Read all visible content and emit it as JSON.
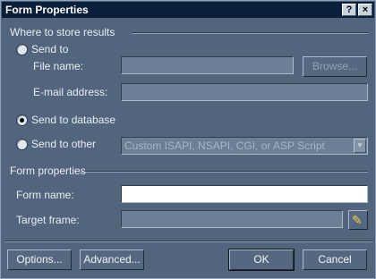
{
  "window": {
    "title": "Form Properties",
    "help_button": "?",
    "close_button": "×"
  },
  "storage_group": {
    "title": "Where to store results",
    "send_to_label": "Send to",
    "file_name_label": "File name:",
    "file_name_value": "",
    "browse_label": "Browse...",
    "email_label": "E-mail address:",
    "email_value": "",
    "send_to_database_label": "Send to database",
    "send_to_other_label": "Send to other",
    "other_select_value": "Custom ISAPI, NSAPI, CGI, or ASP Script",
    "selected": "send_to_database"
  },
  "form_props_group": {
    "title": "Form properties",
    "form_name_label": "Form name:",
    "form_name_value": "",
    "target_frame_label": "Target frame:",
    "target_frame_value": ""
  },
  "footer": {
    "options_label": "Options...",
    "advanced_label": "Advanced...",
    "ok_label": "OK",
    "cancel_label": "Cancel"
  },
  "icons": {
    "pencil": "pencil-icon"
  }
}
